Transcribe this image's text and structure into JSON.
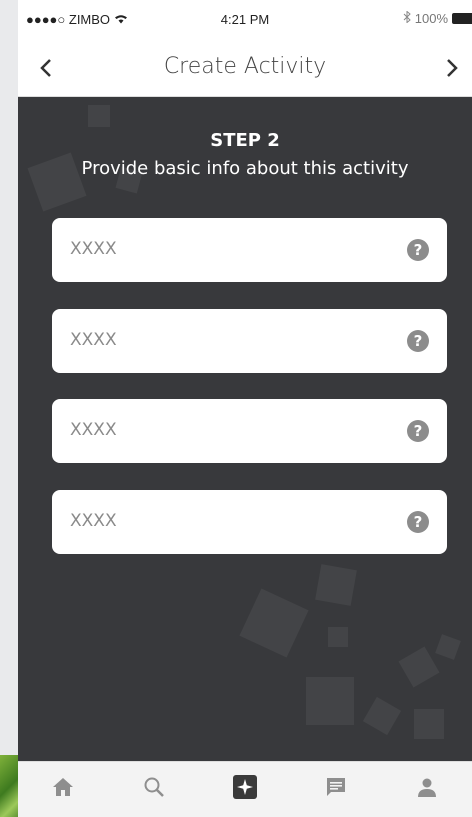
{
  "status_bar": {
    "carrier": "●●●●○ ZIMBO",
    "time": "4:21 PM",
    "battery": "100%"
  },
  "nav": {
    "title": "Create Activity",
    "back_icon": "chevron-left-icon",
    "next_icon": "chevron-right-icon"
  },
  "step": {
    "title": "STEP 2",
    "subtitle": "Provide basic info about this activity"
  },
  "fields": [
    {
      "value": "XXXX",
      "help": "?"
    },
    {
      "value": "XXXX",
      "help": "?"
    },
    {
      "value": "XXXX",
      "help": "?"
    },
    {
      "value": "XXXX",
      "help": "?"
    }
  ],
  "tabs": [
    {
      "icon": "home-icon"
    },
    {
      "icon": "search-icon"
    },
    {
      "icon": "create-activity-icon",
      "active": true
    },
    {
      "icon": "messages-icon"
    },
    {
      "icon": "profile-icon"
    }
  ],
  "colors": {
    "screen_bg": "#38393c",
    "tab_active": "#3a3a3a",
    "tab_inactive": "#8e8e8e"
  }
}
